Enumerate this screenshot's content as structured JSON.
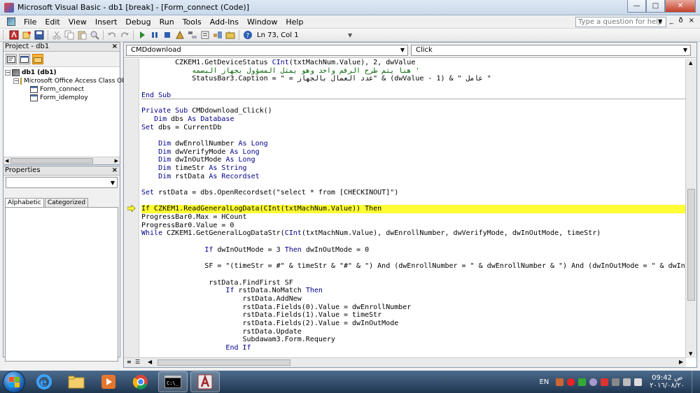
{
  "window": {
    "title": "Microsoft Visual Basic - db1 [break] - [Form_connect (Code)]",
    "btn_minimize": "—",
    "btn_maximize": "□",
    "btn_close": "✕"
  },
  "menu": {
    "items": [
      "File",
      "Edit",
      "View",
      "Insert",
      "Debug",
      "Run",
      "Tools",
      "Add-Ins",
      "Window",
      "Help"
    ],
    "help_placeholder": "Type a question for help",
    "mdi_min": "_",
    "mdi_restore": "ð",
    "mdi_close": "×"
  },
  "toolbar": {
    "position": "Ln 73, Col 1"
  },
  "project": {
    "title": "Project - db1",
    "close": "×",
    "tree": {
      "root": "db1 (db1)",
      "folder": "Microsoft Office Access Class Obj",
      "items": [
        "Form_connect",
        "Form_idemploy"
      ]
    }
  },
  "properties": {
    "title": "Properties",
    "close": "×",
    "tabs": [
      "Alphabetic",
      "Categorized"
    ]
  },
  "code": {
    "object_combo": "CMDdownload",
    "proc_combo": "Click",
    "highlight_index": 18,
    "lines": [
      "        CZKEM1.GetDeviceStatus CInt(txtMachNum.Value), 2, dwValue",
      "            هنا يتم طرح الرقم واحد وهو يمثل المسؤول بجهاز البصمه '",
      "            StatusBar3.Caption = \" = عدد العمال بالجهاز\" & (dwValue - 1) & \" عامل \"",
      "",
      "End Sub",
      "",
      "Private Sub CMDdownload_Click()",
      "   Dim dbs As Database",
      "Set dbs = CurrentDb",
      "",
      "    Dim dwEnrollNumber As Long",
      "    Dim dwVerifyMode As Long",
      "    Dim dwInOutMode As Long",
      "    Dim timeStr As String",
      "    Dim rstData As Recordset",
      "",
      "Set rstData = dbs.OpenRecordset(\"select * from [CHECKINOUT]\")",
      "",
      "If CZKEM1.ReadGeneralLogData(CInt(txtMachNum.Value)) Then",
      "ProgressBar0.Max = HCount",
      "ProgressBar0.Value = 0",
      "While CZKEM1.GetGeneralLogDataStr(CInt(txtMachNum.Value), dwEnrollNumber, dwVerifyMode, dwInOutMode, timeStr)",
      "",
      "               If dwInOutMode = 3 Then dwInOutMode = 0",
      "",
      "               SF = \"(timeStr = #\" & timeStr & \"#\" & \") And (dwEnrollNumber = \" & dwEnrollNumber & \") And (dwInOutMode = \" & dwInOutMode",
      "",
      "                rstData.FindFirst SF",
      "                    If rstData.NoMatch Then",
      "                        rstData.AddNew",
      "                        rstData.Fields(0).Value = dwEnrollNumber",
      "                        rstData.Fields(1).Value = timeStr",
      "                        rstData.Fields(2).Value = dwInOutMode",
      "                        rstData.Update",
      "                        Subdawam3.Form.Requery",
      "                    End If"
    ]
  },
  "taskbar": {
    "lang": "EN",
    "time": "09:42 ص",
    "date": "٢٠١٦/٠٨/٢٠"
  },
  "colors": {
    "highlight": "#ffff33",
    "keyword": "#00008b",
    "comment": "#006400"
  }
}
